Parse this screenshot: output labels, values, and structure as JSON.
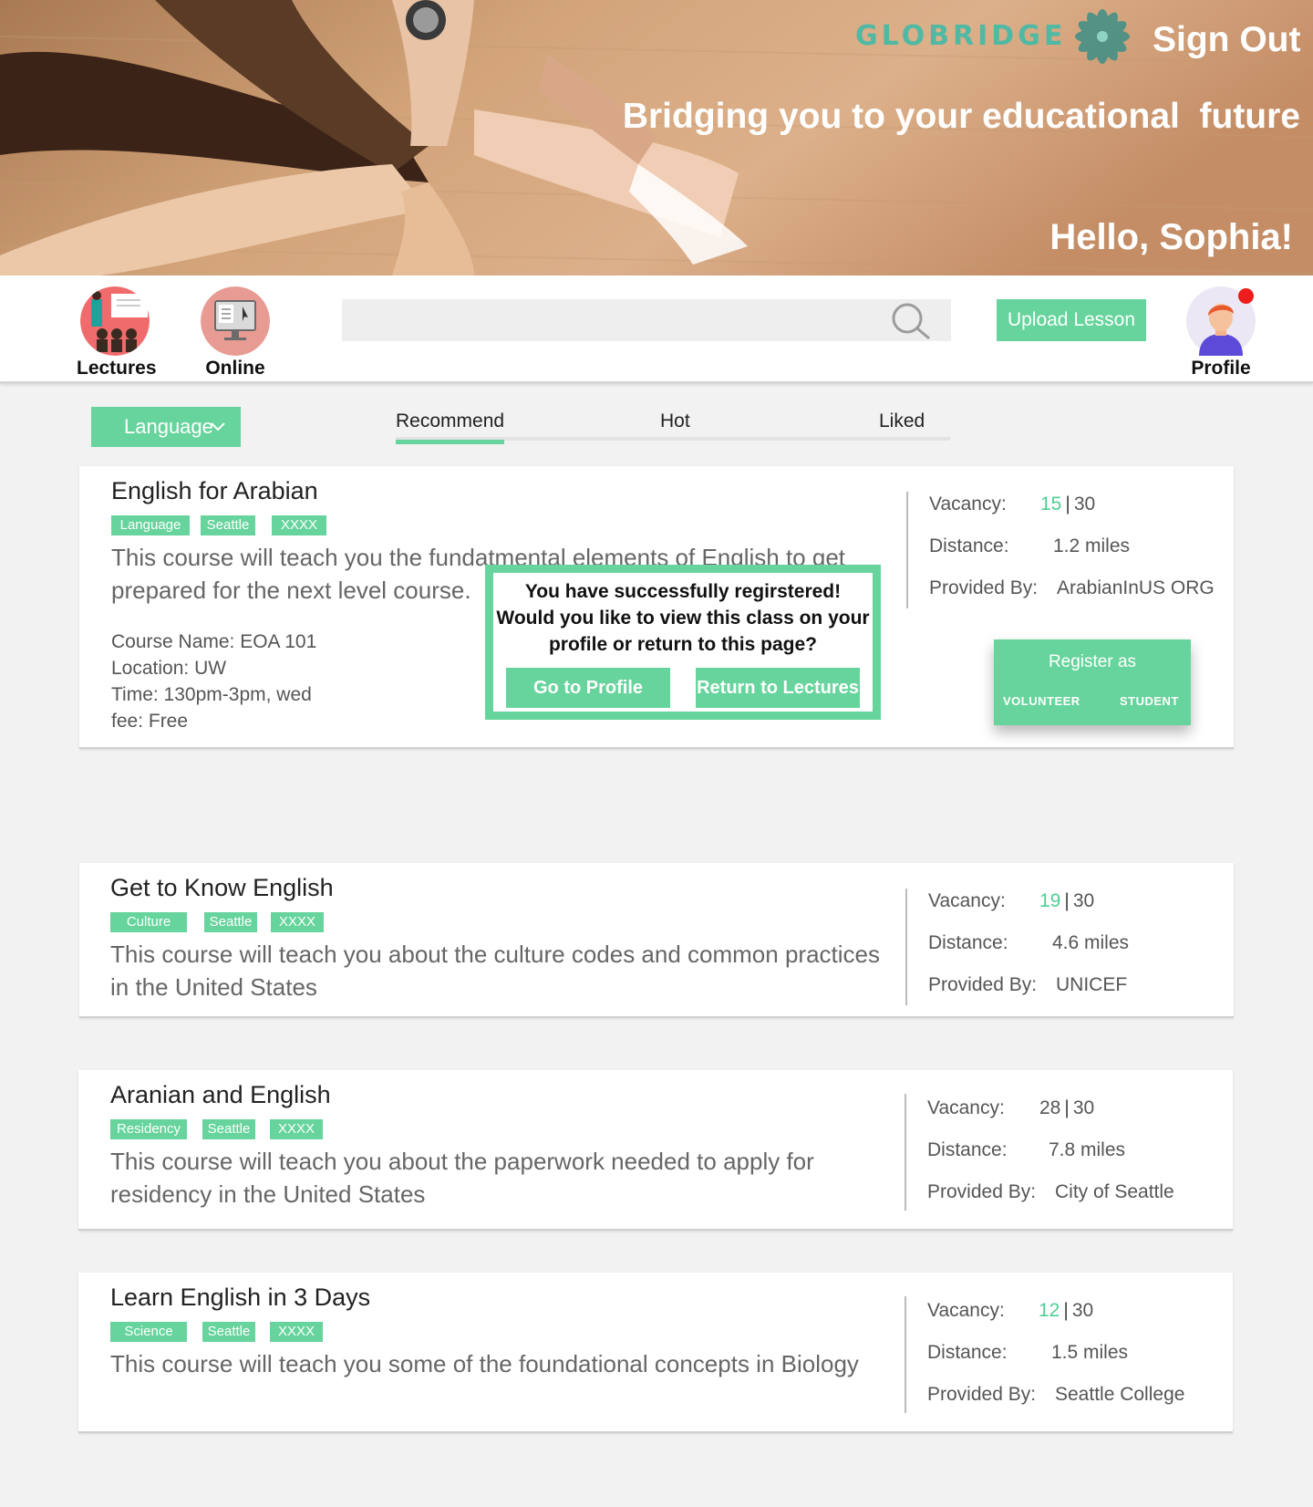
{
  "brand": {
    "name": "GLOBRIDGE",
    "tagline": "Bridging you to your educational  future",
    "accent": "#66d49c",
    "teal": "#4fb9a4"
  },
  "header": {
    "sign_out": "Sign Out",
    "greeting": "Hello, Sophia!"
  },
  "nav": {
    "lectures": "Lectures",
    "online": "Online",
    "search_placeholder": "",
    "upload": "Upload Lesson",
    "profile": "Profile"
  },
  "filters": {
    "language": "Language",
    "tabs": [
      "Recommend",
      "Hot",
      "Liked"
    ],
    "active_tab": "Recommend"
  },
  "labels": {
    "vacancy": "Vacancy:",
    "distance": "Distance:",
    "provided_by": "Provided By:"
  },
  "courses": [
    {
      "title": "English for Arabian",
      "tags": [
        "Language",
        "Seattle",
        "XXXX"
      ],
      "description": "This course will teach you the fundatmental elements of English to get prepared for the next level course.",
      "details": [
        "Course Name: EOA 101",
        "Location: UW",
        "Time: 130pm-3pm, wed",
        "fee: Free"
      ],
      "vacancy_available": "15",
      "vacancy_total": "30",
      "distance": "1.2  miles",
      "provider": "ArabianInUS ORG"
    },
    {
      "title": "Get to Know English",
      "tags": [
        "Culture",
        "Seattle",
        "XXXX"
      ],
      "description": "This course will teach you about the culture codes and common practices in the United States",
      "vacancy_available": "19",
      "vacancy_total": "30",
      "distance": "4.6 miles",
      "provider": "UNICEF"
    },
    {
      "title": "Aranian and English",
      "tags": [
        "Residency",
        "Seattle",
        "XXXX"
      ],
      "description": "This course will teach you about the paperwork needed to apply for residency in the United States",
      "vacancy_available": "28",
      "vacancy_total": "30",
      "distance": "7.8  miles",
      "provider": "City of Seattle"
    },
    {
      "title": "Learn English in 3 Days",
      "tags": [
        "Science",
        "Seattle",
        "XXXX"
      ],
      "description": "This course will teach you some of the foundational concepts in Biology",
      "vacancy_available": "12",
      "vacancy_total": "30",
      "distance": "1.5  miles",
      "provider": "Seattle College"
    }
  ],
  "register": {
    "title": "Register as",
    "volunteer": "VOLUNTEER",
    "student": "STUDENT"
  },
  "modal": {
    "line1": "You have successfully regirstered!",
    "line2": "Would you like to view this class on your",
    "line3": "profile or return to this page?",
    "go_profile": "Go to Profile",
    "return_lectures": "Return to Lectures"
  }
}
